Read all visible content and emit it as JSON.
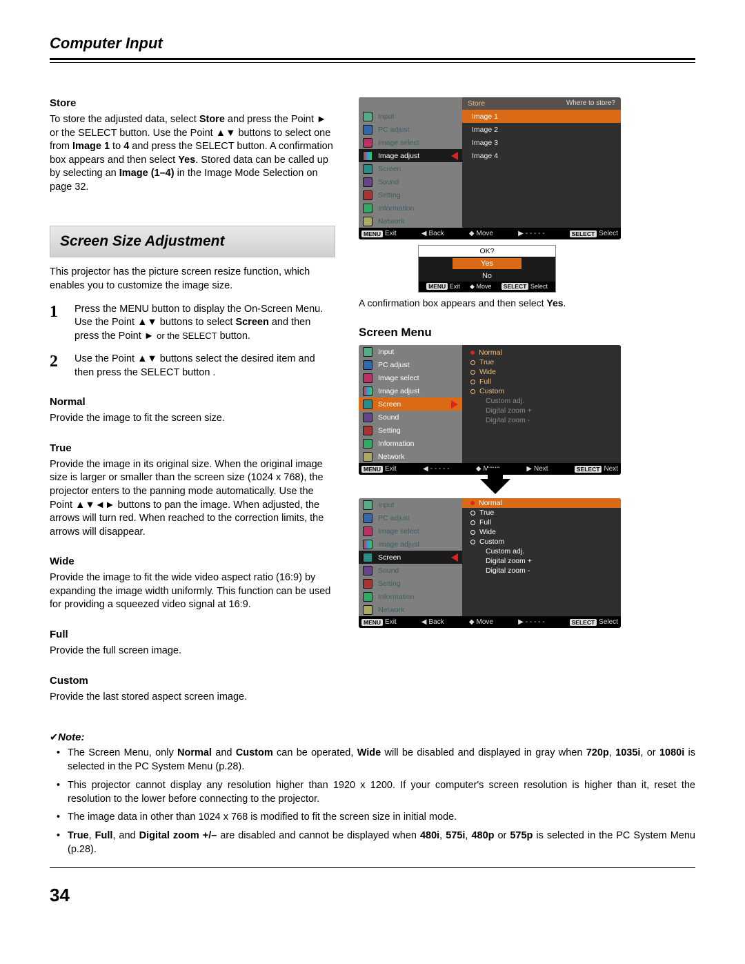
{
  "header": {
    "title": "Computer Input"
  },
  "page_number": "34",
  "store": {
    "heading": "Store",
    "para_a": "To store the adjusted data, select ",
    "para_b": "Store",
    "para_c": " and press the Point ► or the SELECT button. Use the Point ▲▼ buttons to select one from ",
    "para_d": "Image 1",
    "para_e": " to ",
    "para_f": "4",
    "para_g": " and press the SELECT button. A confirmation box appears and then select ",
    "para_h": "Yes",
    "para_i": ". Stored data can be called up by selecting an ",
    "para_j": "Image (1–4)",
    "para_k": " in the Image Mode Selection on page 32."
  },
  "section_bar": "Screen Size Adjustment",
  "intro": "This projector has the picture screen resize function, which enables you to customize the image size.",
  "steps": {
    "s1_num": "1",
    "s1_a": "Press the MENU button to display the On-Screen Menu. Use the Point ▲▼ buttons to select ",
    "s1_b": "Screen",
    "s1_c": " and then press the Point ► ",
    "s1_d": "or the SELECT",
    "s1_e": " button.",
    "s2_num": "2",
    "s2": "Use the Point ▲▼ buttons select the desired item and then press the SELECT button ."
  },
  "defs": {
    "normal_h": "Normal",
    "normal_b": "Provide the image to fit the screen size.",
    "true_h": "True",
    "true_b": "Provide the image in its original size. When the original image size is larger or smaller than the screen size (1024 x 768), the projector enters to the panning  mode automatically. Use the Point ▲▼◄► buttons to pan the image. When adjusted, the arrows will turn red. When reached to the correction limits, the arrows will disappear.",
    "wide_h": "Wide",
    "wide_b": "Provide the image to fit the wide video aspect ratio (16:9) by expanding the image width uniformly. This function can be used for providing a squeezed video signal at 16:9.",
    "full_h": "Full",
    "full_b": "Provide the full screen image.",
    "custom_h": "Custom",
    "custom_b": "Provide the last stored aspect screen image."
  },
  "note": {
    "label": "Note:",
    "b1_a": "The Screen Menu, only ",
    "b1_b": "Normal",
    "b1_c": " and ",
    "b1_d": "Custom",
    "b1_e": " can be operated, ",
    "b1_f": "Wide",
    "b1_g": " will be disabled and displayed in gray when ",
    "b1_h": "720p",
    "b1_i": ", ",
    "b1_j": "1035i",
    "b1_k": ", or ",
    "b1_l": "1080i",
    "b1_m": " is selected in the PC System Menu (p.28).",
    "b2": "This projector cannot display any resolution higher than 1920 x 1200. If your computer's screen resolution is higher than it, reset the resolution to the lower before connecting to the projector.",
    "b3": "The image data in other than 1024 x 768 is modified to fit the screen size in initial mode.",
    "b4_a": "True",
    "b4_b": ", ",
    "b4_c": "Full",
    "b4_d": ", and ",
    "b4_e": "Digital zoom +/–",
    "b4_f": " are disabled and cannot be displayed when ",
    "b4_g": "480i",
    "b4_h": ", ",
    "b4_i": "575i",
    "b4_j": ", ",
    "b4_k": "480p",
    "b4_l": " or ",
    "b4_m": "575p",
    "b4_n": " is selected in the PC System Menu (p.28)."
  },
  "osd1": {
    "header_left": "Store",
    "header_right": "Where to store?",
    "left_items": [
      "Input",
      "PC adjust",
      "Image select",
      "Image adjust",
      "Screen",
      "Sound",
      "Setting",
      "Information",
      "Network"
    ],
    "right_items": [
      "Image 1",
      "Image 2",
      "Image 3",
      "Image 4"
    ],
    "foot": {
      "exit": "Exit",
      "back": "Back",
      "move": "Move",
      "mid": "- - - - -",
      "select": "Select",
      "menu": "MENU",
      "sel": "SELECT"
    }
  },
  "confirm": {
    "ok": "OK?",
    "yes": "Yes",
    "no": "No",
    "foot": {
      "exit": "Exit",
      "move": "Move",
      "select": "Select",
      "menu": "MENU",
      "sel": "SELECT"
    }
  },
  "confirm_caption_a": "A confirmation box appears and then select ",
  "confirm_caption_b": "Yes",
  "confirm_caption_c": ".",
  "screen_menu_label": "Screen Menu",
  "osd2": {
    "left_items": [
      "Input",
      "PC adjust",
      "Image select",
      "Image adjust",
      "Screen",
      "Sound",
      "Setting",
      "Information",
      "Network"
    ],
    "right_items": [
      "Normal",
      "True",
      "Wide",
      "Full",
      "Custom",
      "Custom adj.",
      "Digital zoom +",
      "Digital zoom -"
    ],
    "foot": {
      "exit": "Exit",
      "mid": "- - - - -",
      "move": "Move",
      "next": "Next",
      "next2": "Next",
      "menu": "MENU",
      "sel": "SELECT"
    }
  },
  "osd3": {
    "left_items": [
      "Input",
      "PC adjust",
      "Image select",
      "Image adjust",
      "Screen",
      "Sound",
      "Setting",
      "Information",
      "Network"
    ],
    "right_items": [
      "Normal",
      "True",
      "Full",
      "Wide",
      "Custom",
      "Custom adj.",
      "Digital zoom +",
      "Digital zoom -"
    ],
    "foot": {
      "exit": "Exit",
      "back": "Back",
      "move": "Move",
      "mid": "- - - - -",
      "select": "Select",
      "menu": "MENU",
      "sel": "SELECT"
    }
  }
}
